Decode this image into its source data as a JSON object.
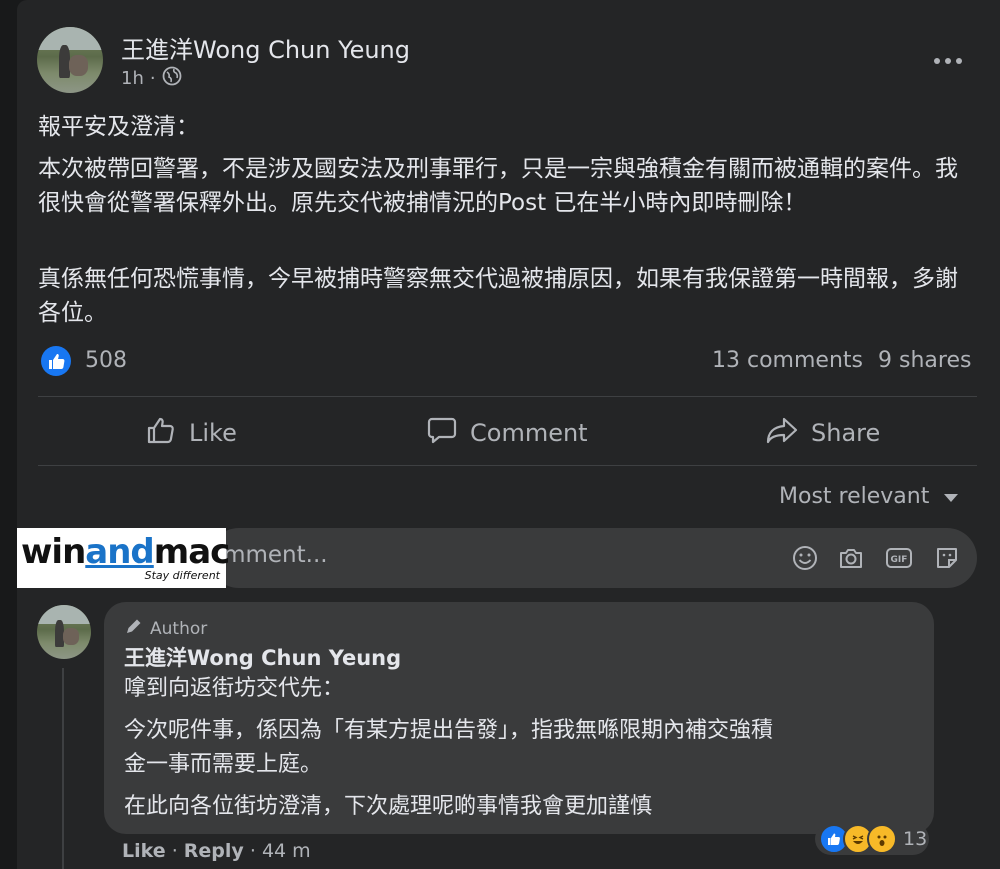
{
  "post": {
    "author_name": "王進洋Wong Chun Yeung",
    "time": "1h",
    "time_separator": "·",
    "paragraphs": [
      "報平安及澄清：",
      "本次被帶回警署，不是涉及國安法及刑事罪行，只是一宗與強積金有關而被通輯的案件。我很快會從警署保釋外出。原先交代被捕情況的Post 已在半小時內即時刪除！",
      "真係無任何恐慌事情，今早被捕時警察無交代過被捕原因，如果有我保證第一時間報，多謝各位。"
    ],
    "reaction_count": "508",
    "comments_count": "13 comments",
    "shares_count": "9 shares"
  },
  "actions": {
    "like": "Like",
    "comment": "Comment",
    "share": "Share"
  },
  "sort": {
    "label": "Most relevant"
  },
  "comment_input": {
    "placeholder": "omment..."
  },
  "watermark": {
    "part1": "win",
    "part2": "and",
    "part3": "mac",
    "tagline": "Stay different"
  },
  "comment": {
    "badge": "Author",
    "author_name": "王進洋Wong Chun Yeung",
    "lines": [
      "嗱到向返街坊交代先：",
      "今次呢件事，係因為「有某方提出告發」，指我無喺限期內補交強積",
      "金一事而需要上庭。",
      "在此向各位街坊澄清，下次處理呢啲事情我會更加謹慎"
    ],
    "reaction_count": "13",
    "like": "Like",
    "reply": "Reply",
    "time": "44 m",
    "sep": "·"
  },
  "colors": {
    "background": "#242526",
    "text": "#e4e6eb",
    "secondary": "#b0b3b8",
    "like_blue": "#1877f2",
    "bubble": "#3a3b3c"
  }
}
